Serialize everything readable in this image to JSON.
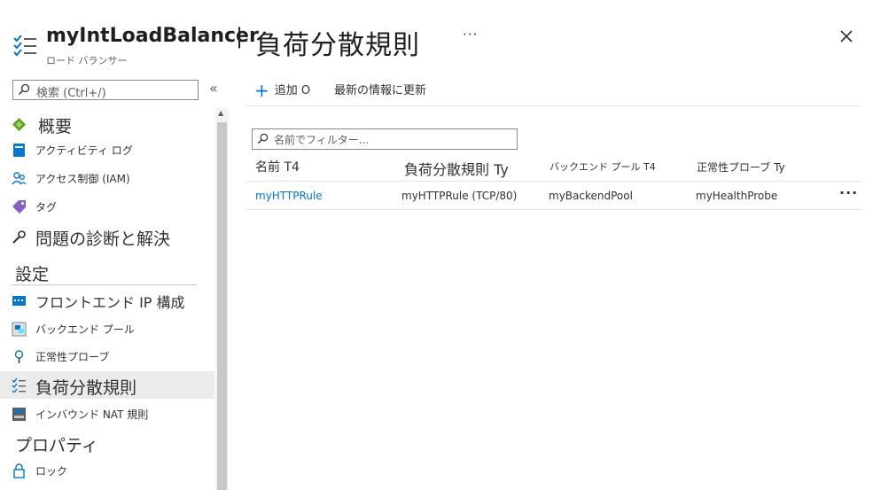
{
  "header": {
    "resource_name": "myIntLoadBalancer",
    "separator": "|",
    "page_title": "負荷分散規則",
    "subtitle": "ロード バランサー",
    "more": "···"
  },
  "sidebar": {
    "search_placeholder": "検索 (Ctrl+/)",
    "collapse": "«",
    "items": [
      {
        "label": "概要",
        "icon": "overview-icon"
      },
      {
        "label": "アクティビティ ログ",
        "icon": "activity-log-icon"
      },
      {
        "label": "アクセス制御 (IAM)",
        "icon": "iam-icon"
      },
      {
        "label": "タグ",
        "icon": "tag-icon"
      },
      {
        "label": "問題の診断と解決",
        "icon": "wrench-icon"
      }
    ],
    "section_settings": "設定",
    "settings_items": [
      {
        "label": "フロントエンド IP 構成",
        "icon": "frontend-ip-icon"
      },
      {
        "label": "バックエンド プール",
        "icon": "backend-pool-icon"
      },
      {
        "label": "正常性プローブ",
        "icon": "health-probe-icon"
      },
      {
        "label": "負荷分散規則",
        "icon": "lb-rules-icon",
        "active": true
      },
      {
        "label": "インバウンド NAT 規則",
        "icon": "nat-rules-icon"
      }
    ],
    "section_properties": "プロパティ",
    "properties_items": [
      {
        "label": "ロック",
        "icon": "lock-icon"
      }
    ]
  },
  "toolbar": {
    "add_label": "追加 O",
    "refresh_label": "最新の情報に更新"
  },
  "filter": {
    "placeholder": "名前でフィルター..."
  },
  "table": {
    "columns": [
      "名前 T4",
      "負荷分散規則 Ty",
      "バックエンド プール T4",
      "正常性プローブ Ty"
    ],
    "rows": [
      {
        "name": "myHTTPRule",
        "rule": "myHTTPRule (TCP/80)",
        "backend_pool": "myBackendPool",
        "health_probe": "myHealthProbe",
        "more": "···"
      }
    ]
  },
  "colors": {
    "accent": "#0078d4",
    "active_item_bg": "#ebebeb"
  }
}
